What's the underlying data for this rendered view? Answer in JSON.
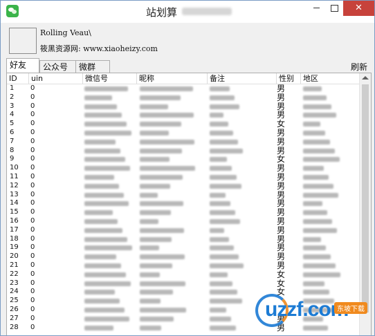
{
  "window": {
    "title": "站划算",
    "buttons": {
      "minimize": "minimize",
      "maximize": "maximize",
      "close": "✕"
    }
  },
  "profile": {
    "nickname": "Rolling Veau\\",
    "site_line": "筱黑资源网: www.xiaoheizy.com"
  },
  "tabs": [
    {
      "label": "好友",
      "active": true
    },
    {
      "label": "公众号",
      "active": false
    },
    {
      "label": "微群",
      "active": false
    }
  ],
  "refresh_label": "刷新",
  "columns": [
    "ID",
    "uin",
    "微信号",
    "昵称",
    "备注",
    "性别",
    "地区"
  ],
  "rows": [
    {
      "id": "1",
      "uin": "0",
      "sex": "男"
    },
    {
      "id": "2",
      "uin": "0",
      "sex": "男"
    },
    {
      "id": "3",
      "uin": "0",
      "sex": "男"
    },
    {
      "id": "4",
      "uin": "0",
      "sex": "男"
    },
    {
      "id": "5",
      "uin": "0",
      "sex": "女"
    },
    {
      "id": "6",
      "uin": "0",
      "sex": "男"
    },
    {
      "id": "7",
      "uin": "0",
      "sex": "男"
    },
    {
      "id": "8",
      "uin": "0",
      "sex": "男"
    },
    {
      "id": "9",
      "uin": "0",
      "sex": "女"
    },
    {
      "id": "10",
      "uin": "0",
      "sex": "男"
    },
    {
      "id": "11",
      "uin": "0",
      "sex": "男"
    },
    {
      "id": "12",
      "uin": "0",
      "sex": "男"
    },
    {
      "id": "13",
      "uin": "0",
      "sex": "男"
    },
    {
      "id": "14",
      "uin": "0",
      "sex": "男"
    },
    {
      "id": "15",
      "uin": "0",
      "sex": "男"
    },
    {
      "id": "16",
      "uin": "0",
      "sex": "男"
    },
    {
      "id": "17",
      "uin": "0",
      "sex": "男"
    },
    {
      "id": "18",
      "uin": "0",
      "sex": "男"
    },
    {
      "id": "19",
      "uin": "0",
      "sex": "男"
    },
    {
      "id": "20",
      "uin": "0",
      "sex": "男"
    },
    {
      "id": "21",
      "uin": "0",
      "sex": "男"
    },
    {
      "id": "22",
      "uin": "0",
      "sex": "女"
    },
    {
      "id": "23",
      "uin": "0",
      "sex": "女"
    },
    {
      "id": "24",
      "uin": "0",
      "sex": "女"
    },
    {
      "id": "25",
      "uin": "0",
      "sex": ""
    },
    {
      "id": "26",
      "uin": "0",
      "sex": ""
    },
    {
      "id": "27",
      "uin": "0",
      "sex": "男"
    },
    {
      "id": "28",
      "uin": "0",
      "sex": "男"
    }
  ],
  "watermark": {
    "logo_text": "uzzf.com",
    "badge": "东坡下载"
  }
}
